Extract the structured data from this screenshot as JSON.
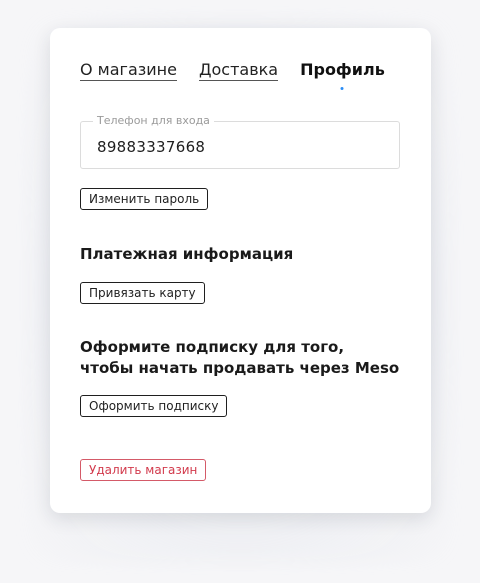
{
  "tabs": [
    {
      "label": "О магазине",
      "active": false
    },
    {
      "label": "Доставка",
      "active": false
    },
    {
      "label": "Профиль",
      "active": true
    }
  ],
  "phone": {
    "label": "Телефон для входа",
    "value": "89883337668"
  },
  "buttons": {
    "change_password": "Изменить пароль",
    "link_card": "Привязать карту",
    "subscribe": "Оформить подписку",
    "delete_store": "Удалить магазин"
  },
  "sections": {
    "payment_title": "Платежная информация",
    "subscription_title_line1": "Оформите подписку для того,",
    "subscription_title_line2": "чтобы начать продавать через Meso"
  },
  "colors": {
    "accent": "#2a8df6",
    "danger": "#d23a4c",
    "text": "#1a1a1a"
  }
}
